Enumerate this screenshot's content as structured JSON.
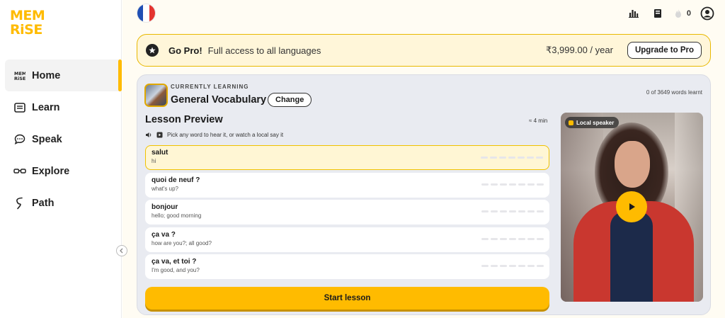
{
  "sidebar": {
    "logo": "MEM\nRiSE",
    "items": [
      {
        "label": "Home",
        "icon": "memrise-logo-icon",
        "active": true
      },
      {
        "label": "Learn",
        "icon": "book-icon"
      },
      {
        "label": "Speak",
        "icon": "chat-bubble-icon"
      },
      {
        "label": "Explore",
        "icon": "glasses-icon"
      },
      {
        "label": "Path",
        "icon": "path-icon"
      }
    ]
  },
  "topbar": {
    "flag": "france-flag-icon",
    "streak_count": "0"
  },
  "pro_banner": {
    "title": "Go Pro!",
    "text": "Full access to all languages",
    "price": "₹3,999.00 / year",
    "button": "Upgrade to Pro"
  },
  "course": {
    "currently_learning": "CURRENTLY LEARNING",
    "title": "General Vocabulary",
    "change_button": "Change",
    "words_learnt": "0 of 3649 words learnt"
  },
  "lesson": {
    "title": "Lesson Preview",
    "time": "≈ 4 min",
    "hint": "Pick any word to hear it, or watch a local say it",
    "words": [
      {
        "word": "salut",
        "translation": "hi",
        "active": true
      },
      {
        "word": "quoi de neuf ?",
        "translation": "what's up?"
      },
      {
        "word": "bonjour",
        "translation": "hello; good morning"
      },
      {
        "word": "ça va ?",
        "translation": "how are you?; all good?"
      },
      {
        "word": "ça va, et toi ?",
        "translation": "I'm good, and you?"
      }
    ],
    "start_button": "Start lesson"
  },
  "video": {
    "badge": "Local speaker"
  },
  "colors": {
    "brand": "#ffbb00",
    "banner_bg": "#fff6d9",
    "card_bg": "#e9ebf1"
  }
}
